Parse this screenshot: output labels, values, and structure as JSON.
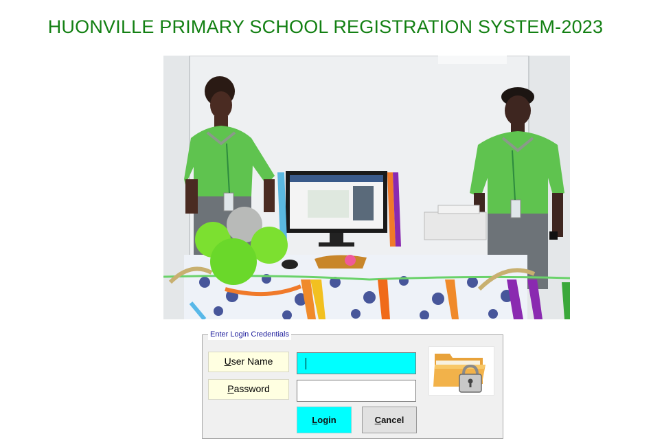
{
  "app": {
    "title": "HUONVILLE PRIMARY SCHOOL REGISTRATION SYSTEM-2023"
  },
  "login": {
    "frame_caption": "Enter Login Credentials",
    "username_label": "User Name",
    "password_label": "Password",
    "username_value": "",
    "password_value": "",
    "login_button": "Login",
    "cancel_button": "Cancel"
  },
  "colors": {
    "title": "#138013",
    "active_field": "#00ffff",
    "label_background": "#ffffe1",
    "login_button": "#00ffff",
    "cancel_button": "#e1e1e1"
  },
  "icons": {
    "lock": "folder-lock-icon"
  }
}
